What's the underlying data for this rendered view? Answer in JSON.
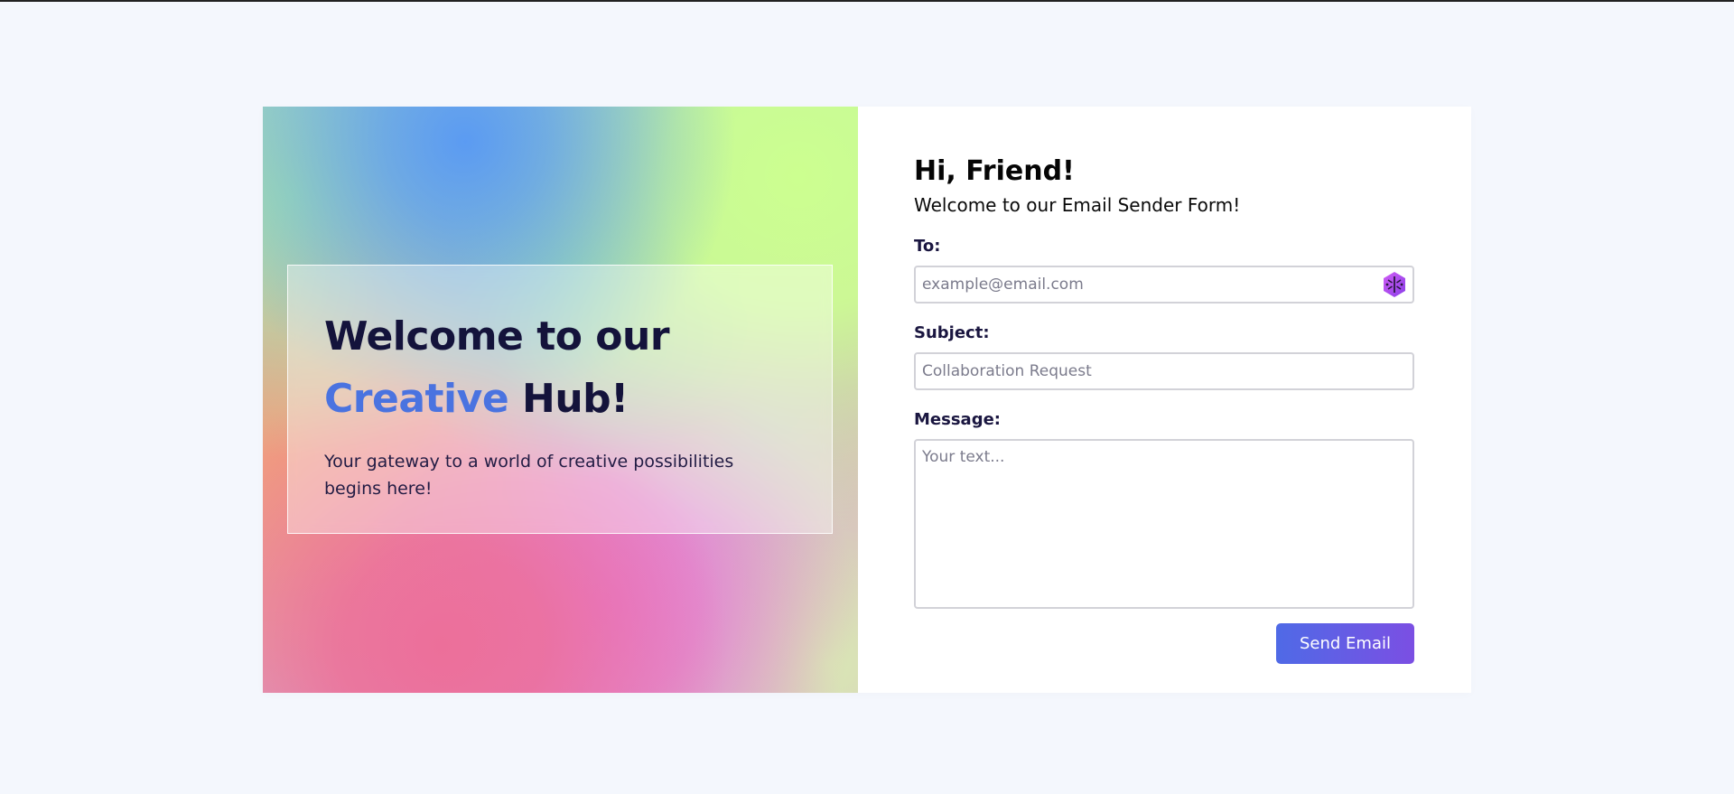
{
  "hero": {
    "title_line1": "Welcome to our",
    "title_accent": "Creative",
    "title_rest": " Hub!",
    "subtitle": "Your gateway to a world of creative possibilities begins here!"
  },
  "form": {
    "greeting": "Hi, Friend!",
    "intro": "Welcome to our Email Sender Form!",
    "to_label": "To:",
    "to_placeholder": "example@email.com",
    "to_value": "",
    "subject_label": "Subject:",
    "subject_placeholder": "Collaboration Request",
    "subject_value": "",
    "message_label": "Message:",
    "message_placeholder": "Your text...",
    "message_value": "",
    "send_label": "Send Email",
    "extension_icon": "hexagon-extension-icon"
  },
  "colors": {
    "page_background": "#f4f7fd",
    "accent_blue": "#4a73e0",
    "heading_navy": "#14133b",
    "button_gradient_start": "#4f6ae6",
    "button_gradient_end": "#7b4fe3",
    "extension_icon_purple": "#b64cf2"
  }
}
